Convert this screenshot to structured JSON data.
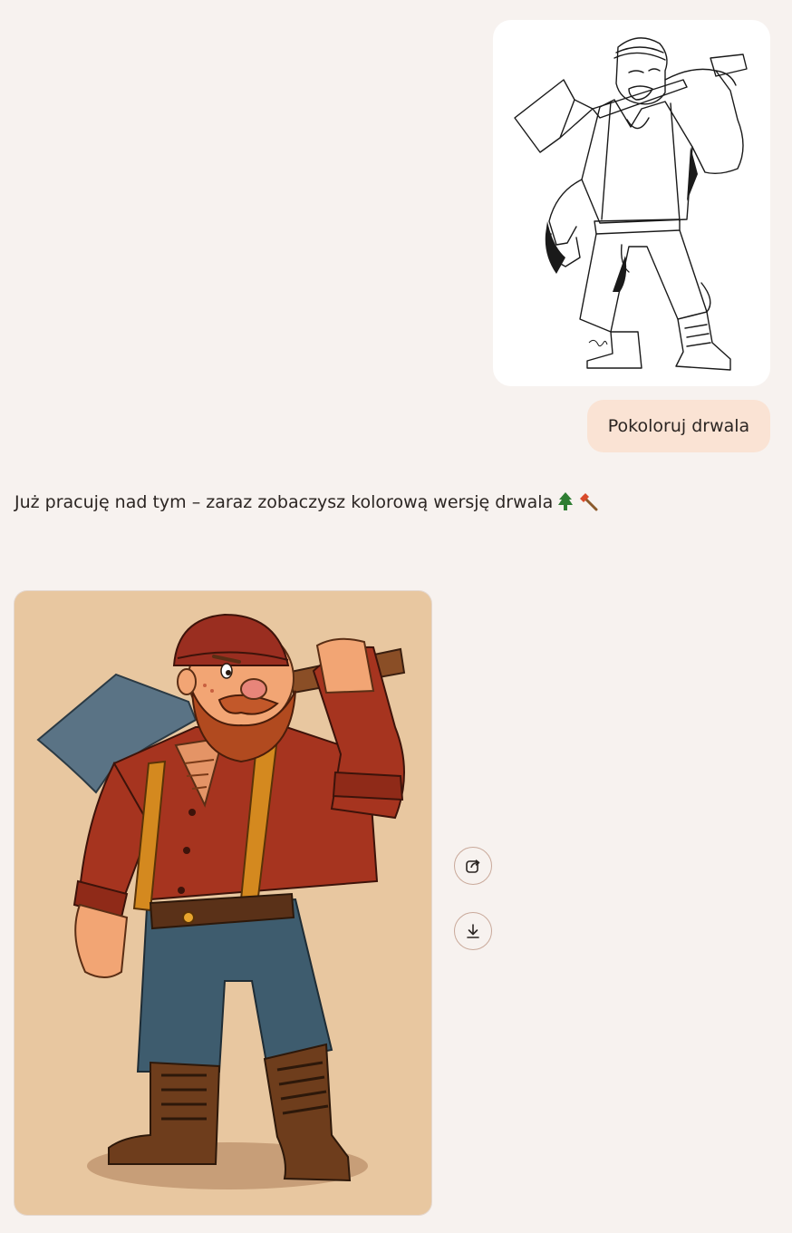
{
  "conversation": {
    "user_message": {
      "image": {
        "alt": "Szkic drwala",
        "signature_icon": "sketch-signature"
      },
      "text": "Pokoloruj drwala"
    },
    "assistant_message": {
      "text": "Już pracuję nad tym – zaraz zobaczysz kolorową wersję drwala",
      "emojis": [
        "tree-icon",
        "axe-icon"
      ],
      "image": {
        "alt": "Kolorowy drwal"
      },
      "actions": [
        {
          "name": "share",
          "icon": "share-icon"
        },
        {
          "name": "download",
          "icon": "download-icon"
        }
      ]
    }
  },
  "colors": {
    "page_bg": "#f7f2ef",
    "user_bubble_bg": "#fae3d4",
    "card_bg": "#e8c7a0",
    "shirt": "#a6341f",
    "jeans": "#3e5c6e",
    "suspenders": "#d4891f",
    "boots": "#6e3d1c",
    "beard": "#b14a1f",
    "axe_head": "#5a7385",
    "button_border": "#c9a99a"
  }
}
